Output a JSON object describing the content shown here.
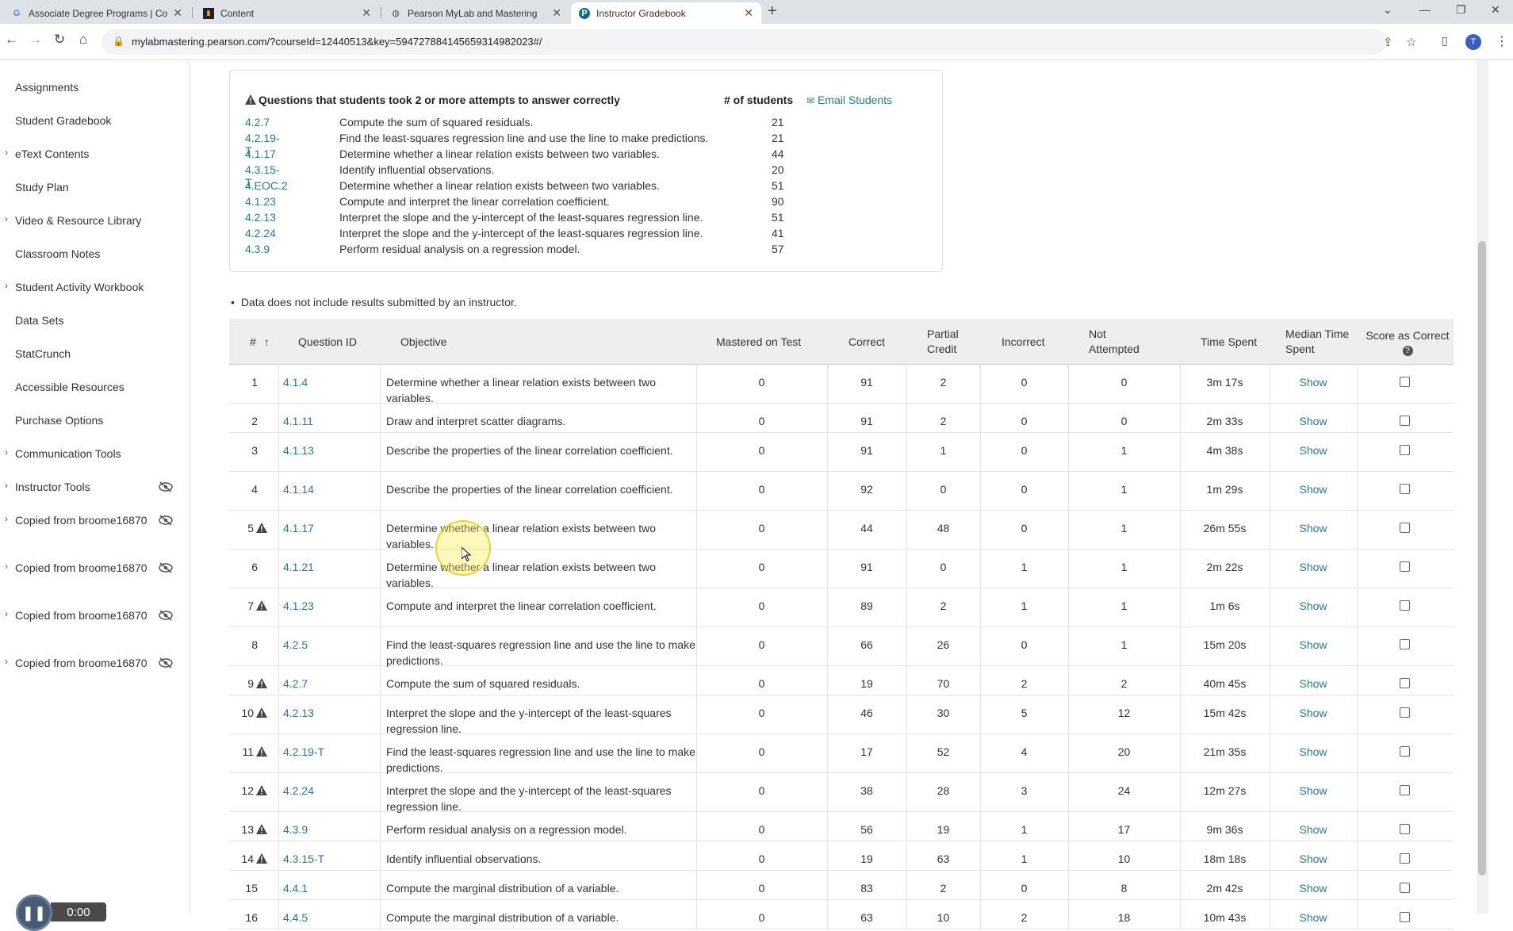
{
  "browser": {
    "tabs": [
      {
        "label": "Associate Degree Programs | Co",
        "icon": "G"
      },
      {
        "label": "Content",
        "icon": "bars"
      },
      {
        "label": "Pearson MyLab and Mastering",
        "icon": "globe"
      },
      {
        "label": "Instructor Gradebook",
        "icon": "P"
      }
    ],
    "url": "mylabmastering.pearson.com/?courseId=12440513&key=594727884145659314982023#/",
    "profile_initial": "T"
  },
  "sidebar": {
    "items": [
      {
        "label": "Assignments",
        "chevron": false,
        "hidden": false
      },
      {
        "label": "Student Gradebook",
        "chevron": false,
        "hidden": false
      },
      {
        "label": "eText Contents",
        "chevron": true,
        "hidden": false
      },
      {
        "label": "Study Plan",
        "chevron": false,
        "hidden": false
      },
      {
        "label": "Video & Resource Library",
        "chevron": true,
        "hidden": false
      },
      {
        "label": "Classroom Notes",
        "chevron": false,
        "hidden": false
      },
      {
        "label": "Student Activity Workbook",
        "chevron": true,
        "hidden": false
      },
      {
        "label": "Data Sets",
        "chevron": false,
        "hidden": false
      },
      {
        "label": "StatCrunch",
        "chevron": false,
        "hidden": false
      },
      {
        "label": "Accessible Resources",
        "chevron": false,
        "hidden": false
      },
      {
        "label": "Purchase Options",
        "chevron": false,
        "hidden": false
      },
      {
        "label": "Communication Tools",
        "chevron": true,
        "hidden": false
      },
      {
        "label": "Instructor Tools",
        "chevron": true,
        "hidden": true
      },
      {
        "label": "Copied from broome16870",
        "chevron": true,
        "hidden": true
      },
      {
        "label": "Copied from broome16870",
        "chevron": true,
        "hidden": true
      },
      {
        "label": "Copied from broome16870",
        "chevron": true,
        "hidden": true
      },
      {
        "label": "Copied from broome16870",
        "chevron": true,
        "hidden": true
      }
    ]
  },
  "media": {
    "time": "0:00"
  },
  "summary": {
    "heading": "Questions that students took 2 or more attempts to answer correctly",
    "count_header": "# of students",
    "email_label": "Email Students",
    "rows": [
      {
        "id": "4.2.7",
        "objective": "Compute the sum of squared residuals.",
        "count": "21"
      },
      {
        "id": "4.2.19-T",
        "objective": "Find the least-squares regression line and use the line to make predictions.",
        "count": "21"
      },
      {
        "id": "4.1.17",
        "objective": "Determine whether a linear relation exists between two variables.",
        "count": "44"
      },
      {
        "id": "4.3.15-T",
        "objective": "Identify influential observations.",
        "count": "20"
      },
      {
        "id": "4.EOC.2",
        "objective": "Determine whether a linear relation exists between two variables.",
        "count": "51"
      },
      {
        "id": "4.1.23",
        "objective": "Compute and interpret the linear correlation coefficient.",
        "count": "90"
      },
      {
        "id": "4.2.13",
        "objective": "Interpret the slope and the y-intercept of the least-squares regression line.",
        "count": "51"
      },
      {
        "id": "4.2.24",
        "objective": "Interpret the slope and the y-intercept of the least-squares regression line.",
        "count": "41"
      },
      {
        "id": "4.3.9",
        "objective": "Perform residual analysis on a regression model.",
        "count": "57"
      }
    ]
  },
  "note": "Data does not include results submitted by an instructor.",
  "table": {
    "headers": {
      "num": "#",
      "qid": "Question ID",
      "objective": "Objective",
      "mastered": "Mastered on Test",
      "correct": "Correct",
      "partial": "Partial Credit",
      "incorrect": "Incorrect",
      "not_attempted": "Not Attempted",
      "time_spent": "Time Spent",
      "median": "Median Time Spent",
      "score": "Score as Correct"
    },
    "rows": [
      {
        "n": "1",
        "warn": false,
        "qid": "4.1.4",
        "obj": "Determine whether a linear relation exists between two variables.",
        "mastered": "0",
        "correct": "91",
        "partial": "2",
        "incorrect": "0",
        "na": "0",
        "time": "3m 17s",
        "show": "Show"
      },
      {
        "n": "2",
        "warn": false,
        "qid": "4.1.11",
        "obj": "Draw and interpret scatter diagrams.",
        "mastered": "0",
        "correct": "91",
        "partial": "2",
        "incorrect": "0",
        "na": "0",
        "time": "2m 33s",
        "show": "Show"
      },
      {
        "n": "3",
        "warn": false,
        "qid": "4.1.13",
        "obj": "Describe the properties of the linear correlation coefficient.",
        "mastered": "0",
        "correct": "91",
        "partial": "1",
        "incorrect": "0",
        "na": "1",
        "time": "4m 38s",
        "show": "Show"
      },
      {
        "n": "4",
        "warn": false,
        "qid": "4.1.14",
        "obj": "Describe the properties of the linear correlation coefficient.",
        "mastered": "0",
        "correct": "92",
        "partial": "0",
        "incorrect": "0",
        "na": "1",
        "time": "1m 29s",
        "show": "Show"
      },
      {
        "n": "5",
        "warn": true,
        "qid": "4.1.17",
        "obj": "Determine whether a linear relation exists between two variables.",
        "mastered": "0",
        "correct": "44",
        "partial": "48",
        "incorrect": "0",
        "na": "1",
        "time": "26m 55s",
        "show": "Show"
      },
      {
        "n": "6",
        "warn": false,
        "qid": "4.1.21",
        "obj": "Determine whether a linear relation exists between two variables.",
        "mastered": "0",
        "correct": "91",
        "partial": "0",
        "incorrect": "1",
        "na": "1",
        "time": "2m 22s",
        "show": "Show"
      },
      {
        "n": "7",
        "warn": true,
        "qid": "4.1.23",
        "obj": "Compute and interpret the linear correlation coefficient.",
        "mastered": "0",
        "correct": "89",
        "partial": "2",
        "incorrect": "1",
        "na": "1",
        "time": "1m 6s",
        "show": "Show"
      },
      {
        "n": "8",
        "warn": false,
        "qid": "4.2.5",
        "obj": "Find the least-squares regression line and use the line to make predictions.",
        "mastered": "0",
        "correct": "66",
        "partial": "26",
        "incorrect": "0",
        "na": "1",
        "time": "15m 20s",
        "show": "Show"
      },
      {
        "n": "9",
        "warn": true,
        "qid": "4.2.7",
        "obj": "Compute the sum of squared residuals.",
        "mastered": "0",
        "correct": "19",
        "partial": "70",
        "incorrect": "2",
        "na": "2",
        "time": "40m 45s",
        "show": "Show"
      },
      {
        "n": "10",
        "warn": true,
        "qid": "4.2.13",
        "obj": "Interpret the slope and the y-intercept of the least-squares regression line.",
        "mastered": "0",
        "correct": "46",
        "partial": "30",
        "incorrect": "5",
        "na": "12",
        "time": "15m 42s",
        "show": "Show"
      },
      {
        "n": "11",
        "warn": true,
        "qid": "4.2.19-T",
        "obj": "Find the least-squares regression line and use the line to make predictions.",
        "mastered": "0",
        "correct": "17",
        "partial": "52",
        "incorrect": "4",
        "na": "20",
        "time": "21m 35s",
        "show": "Show"
      },
      {
        "n": "12",
        "warn": true,
        "qid": "4.2.24",
        "obj": "Interpret the slope and the y-intercept of the least-squares regression line.",
        "mastered": "0",
        "correct": "38",
        "partial": "28",
        "incorrect": "3",
        "na": "24",
        "time": "12m 27s",
        "show": "Show"
      },
      {
        "n": "13",
        "warn": true,
        "qid": "4.3.9",
        "obj": "Perform residual analysis on a regression model.",
        "mastered": "0",
        "correct": "56",
        "partial": "19",
        "incorrect": "1",
        "na": "17",
        "time": "9m 36s",
        "show": "Show"
      },
      {
        "n": "14",
        "warn": true,
        "qid": "4.3.15-T",
        "obj": "Identify influential observations.",
        "mastered": "0",
        "correct": "19",
        "partial": "63",
        "incorrect": "1",
        "na": "10",
        "time": "18m 18s",
        "show": "Show"
      },
      {
        "n": "15",
        "warn": false,
        "qid": "4.4.1",
        "obj": "Compute the marginal distribution of a variable.",
        "mastered": "0",
        "correct": "83",
        "partial": "2",
        "incorrect": "0",
        "na": "8",
        "time": "2m 42s",
        "show": "Show"
      },
      {
        "n": "16",
        "warn": false,
        "qid": "4.4.5",
        "obj": "Compute the marginal distribution of a variable.",
        "mastered": "0",
        "correct": "63",
        "partial": "10",
        "incorrect": "2",
        "na": "18",
        "time": "10m 43s",
        "show": "Show"
      }
    ]
  },
  "colors": {
    "link": "#2a7b8a",
    "header_bg": "#eeeeee"
  }
}
